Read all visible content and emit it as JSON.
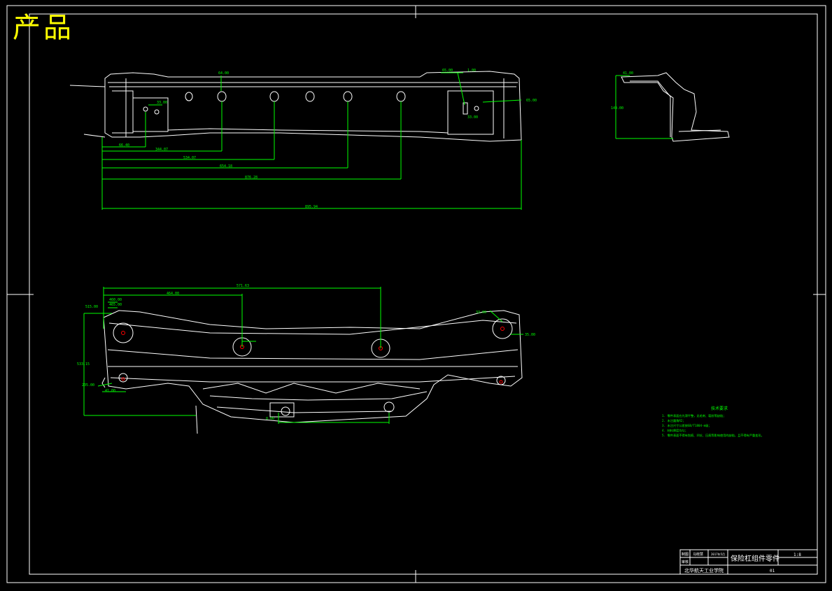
{
  "header": {
    "title": "产品"
  },
  "colors": {
    "outline": "#ffffff",
    "dimension": "#00ff00",
    "accent": "#ffff00",
    "marker": "#ff0000",
    "background": "#000000"
  },
  "top_view": {
    "dims_horizontal": [
      "66.40",
      "344.07",
      "534.07",
      "654.18",
      "876.28",
      "895.94"
    ],
    "callouts": [
      "64.00",
      "65.00",
      "1.00",
      "33.00",
      "65.00",
      "33.00"
    ]
  },
  "side_view": {
    "dims": [
      "41.00",
      "149.00"
    ]
  },
  "bottom_view": {
    "dims_top": [
      "571.63",
      "464.00"
    ],
    "dims_left": [
      "515.00",
      "460.00",
      "465.00"
    ],
    "dims_side": [
      "533.15",
      "235.00"
    ],
    "callouts_right": [
      "33.00",
      "35.00"
    ],
    "dims_bottom": [
      "41.00",
      "8.00"
    ]
  },
  "notes": {
    "title": "技术要求",
    "items": [
      "1. 零件表面应光滑平整，无毛刺、裂纹等缺陷；",
      "2. 未注圆角R2；",
      "3. 未注尺寸公差按GB/T1804-m级；",
      "4. 材料厚度均匀；",
      "5. 零件表面不得有划痕、凹坑、压痕等影响使用的缺陷，且不得有严重变形。"
    ]
  },
  "title_block": {
    "drawing_name": "保险杠组件零件",
    "scale": "1:8",
    "school": "北华航天工业学院",
    "sheet": "01",
    "row1_label": "制图",
    "row1_name": "马晓慧",
    "row1_date": "2017年5月",
    "row2_label": "审核"
  }
}
